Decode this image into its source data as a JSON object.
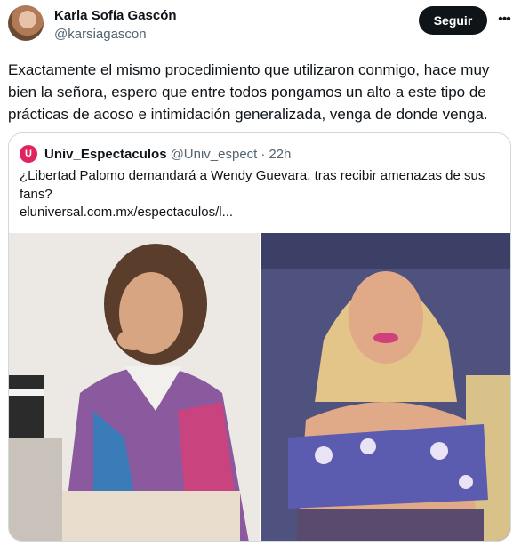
{
  "author": {
    "name": "Karla Sofía Gascón",
    "handle": "@karsiagascon",
    "follow_label": "Seguir",
    "more_icon": "more-horizontal-icon"
  },
  "tweet": {
    "text": "Exactamente el mismo procedimiento que utilizaron conmigo, hace muy bien la señora, espero que entre todos pongamos un alto a este tipo de prácticas de acoso e intimidación generalizada, venga de donde venga."
  },
  "quoted": {
    "name": "Univ_Espectaculos",
    "handle": "@Univ_espect",
    "separator": "·",
    "time": "22h",
    "logo_letter": "U",
    "text": "¿Libertad Palomo demandará a Wendy Guevara, tras recibir amenazas de sus fans?",
    "link": "eluniversal.com.mx/espectaculos/l..."
  },
  "colors": {
    "follow_bg": "#0f1419",
    "secondary_text": "#536471",
    "border": "#cfd9de",
    "logo": "#e0245e"
  }
}
